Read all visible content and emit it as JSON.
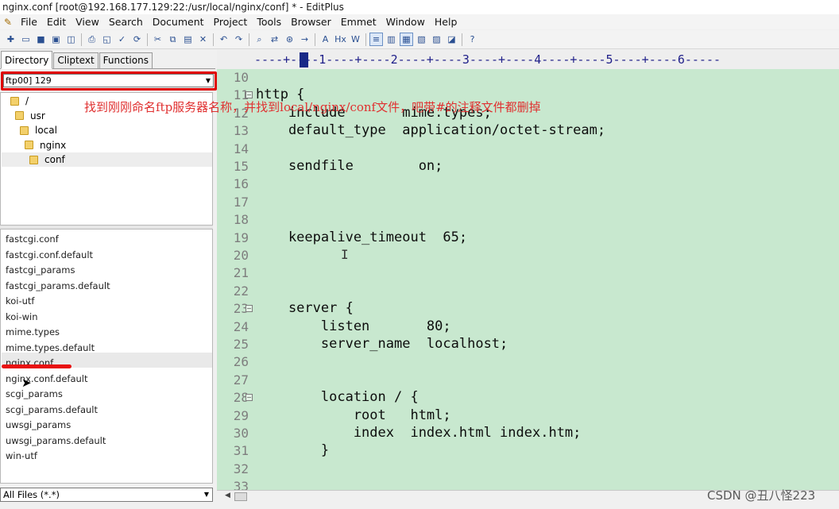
{
  "window": {
    "title": "nginx.conf [root@192.168.177.129:22:/usr/local/nginx/conf] * - EditPlus"
  },
  "menu": [
    "File",
    "Edit",
    "View",
    "Search",
    "Document",
    "Project",
    "Tools",
    "Browser",
    "Emmet",
    "Window",
    "Help"
  ],
  "toolbar": {
    "icons": [
      {
        "name": "new-file-icon",
        "glyph": "✚"
      },
      {
        "name": "open-folder-icon",
        "glyph": "▭"
      },
      {
        "name": "save-icon",
        "glyph": "■"
      },
      {
        "name": "save-all-icon",
        "glyph": "▣"
      },
      {
        "name": "ftp-upload-icon",
        "glyph": "◫"
      },
      {
        "name": "print-icon",
        "glyph": "⎙"
      },
      {
        "name": "print-preview-icon",
        "glyph": "◱"
      },
      {
        "name": "spell-check-icon",
        "glyph": "✓"
      },
      {
        "name": "refresh-icon",
        "glyph": "⟳"
      },
      {
        "name": "cut-icon",
        "glyph": "✂"
      },
      {
        "name": "copy-icon",
        "glyph": "⧉"
      },
      {
        "name": "paste-icon",
        "glyph": "▤"
      },
      {
        "name": "delete-icon",
        "glyph": "✕"
      },
      {
        "name": "undo-icon",
        "glyph": "↶"
      },
      {
        "name": "redo-icon",
        "glyph": "↷"
      },
      {
        "name": "find-icon",
        "glyph": "⌕"
      },
      {
        "name": "replace-icon",
        "glyph": "⇄"
      },
      {
        "name": "find-in-files-icon",
        "glyph": "⊛"
      },
      {
        "name": "go-to-line-icon",
        "glyph": "→"
      },
      {
        "name": "font-icon",
        "glyph": "A"
      },
      {
        "name": "hex-viewer-icon",
        "glyph": "Hx"
      },
      {
        "name": "word-wrap-icon",
        "glyph": "W"
      },
      {
        "name": "line-numbers-icon",
        "glyph": "≡"
      },
      {
        "name": "ruler-icon",
        "glyph": "▥"
      },
      {
        "name": "column-select-icon",
        "glyph": "▦"
      },
      {
        "name": "cliptext-window-icon",
        "glyph": "▧"
      },
      {
        "name": "output-window-icon",
        "glyph": "▨"
      },
      {
        "name": "browser-icon",
        "glyph": "◪"
      },
      {
        "name": "help-icon",
        "glyph": "?"
      }
    ]
  },
  "sidebar": {
    "tabs": [
      "Directory",
      "Cliptext",
      "Functions"
    ],
    "drive": "ftp00] 129",
    "dirs": [
      {
        "label": "/",
        "indent": 0
      },
      {
        "label": "usr",
        "indent": 1
      },
      {
        "label": "local",
        "indent": 2
      },
      {
        "label": "nginx",
        "indent": 3
      },
      {
        "label": "conf",
        "indent": 4
      }
    ],
    "files": [
      "fastcgi.conf",
      "fastcgi.conf.default",
      "fastcgi_params",
      "fastcgi_params.default",
      "koi-utf",
      "koi-win",
      "mime.types",
      "mime.types.default",
      "nginx.conf",
      "nginx.conf.default",
      "scgi_params",
      "scgi_params.default",
      "uwsgi_params",
      "uwsgi_params.default",
      "win-utf"
    ],
    "filter": "All Files (*.*)"
  },
  "ruler": {
    "text": "----+----1----+----2----+----3----+----4----+----5----+----6-----"
  },
  "editor": {
    "lines": [
      {
        "num": "10",
        "code": ""
      },
      {
        "num": "11",
        "code": "http {",
        "fold": true
      },
      {
        "num": "12",
        "code": "    include       mime.types;"
      },
      {
        "num": "13",
        "code": "    default_type  application/octet-stream;"
      },
      {
        "num": "14",
        "code": ""
      },
      {
        "num": "15",
        "code": "    sendfile        on;"
      },
      {
        "num": "16",
        "code": ""
      },
      {
        "num": "17",
        "code": ""
      },
      {
        "num": "18",
        "code": ""
      },
      {
        "num": "19",
        "code": "    keepalive_timeout  65;"
      },
      {
        "num": "20",
        "code": ""
      },
      {
        "num": "21",
        "code": ""
      },
      {
        "num": "22",
        "code": ""
      },
      {
        "num": "23",
        "code": "    server {",
        "fold": true
      },
      {
        "num": "24",
        "code": "        listen       80;"
      },
      {
        "num": "25",
        "code": "        server_name  localhost;"
      },
      {
        "num": "26",
        "code": ""
      },
      {
        "num": "27",
        "code": ""
      },
      {
        "num": "28",
        "code": "        location / {",
        "fold": true
      },
      {
        "num": "29",
        "code": "            root   html;"
      },
      {
        "num": "30",
        "code": "            index  index.html index.htm;"
      },
      {
        "num": "31",
        "code": "        }"
      },
      {
        "num": "32",
        "code": ""
      },
      {
        "num": "33",
        "code": ""
      }
    ],
    "annotation": "找到刚刚命名ftp服务器名称，并找到local/nginx/conf文件，吧带#的注释文件都删掉",
    "colors": {
      "background": "#c8e8cf",
      "annotation": "#e03030",
      "highlight_box": "#e00000"
    }
  },
  "watermark": "CSDN @丑八怪223"
}
